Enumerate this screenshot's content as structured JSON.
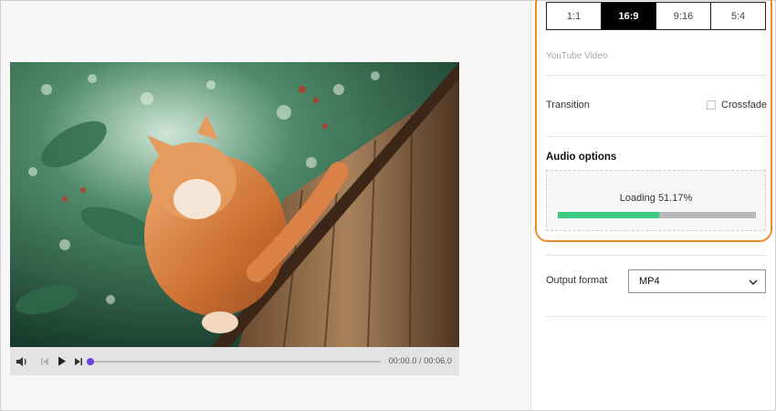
{
  "ratios": [
    {
      "label": "1:1",
      "active": false
    },
    {
      "label": "16:9",
      "active": true
    },
    {
      "label": "9:16",
      "active": false
    },
    {
      "label": "5:4",
      "active": false
    }
  ],
  "ratio_caption": "YouTube Video",
  "transition": {
    "label": "Transition",
    "crossfade_label": "Crossfade",
    "crossfade_checked": false
  },
  "audio": {
    "title": "Audio options",
    "loading_text": "Loading 51.17%",
    "progress": 0.5117
  },
  "output": {
    "label": "Output format",
    "value": "MP4"
  },
  "player": {
    "time": "00:00.0 / 00:06.0",
    "position": 0
  },
  "colors": {
    "accent_orange": "#ec8a2c",
    "progress_green": "#3ccb84",
    "scrub_knob": "#6a45e0"
  }
}
